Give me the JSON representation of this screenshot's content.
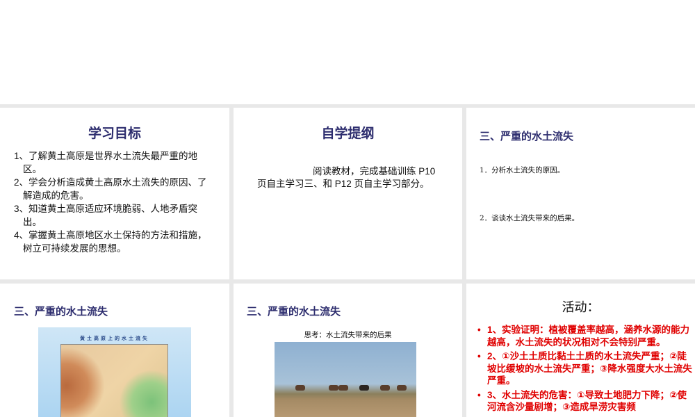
{
  "slide1": {
    "title": "学习目标",
    "items": [
      "1、了解黄土高原是世界水土流失最严重的地区。",
      "2、学会分析造成黄土高原水土流失的原因、了解造成的危害。",
      "3、知道黄土高原适应环境脆弱、人地矛盾突出。",
      "4、掌握黄土高原地区水土保持的方法和措施，树立可持续发展的思想。"
    ]
  },
  "slide2": {
    "title": "自学提纲",
    "line1": "阅读教材，完成基础训练 P10",
    "line2": "页自主学习三、和 P12 页自主学习部分。"
  },
  "slide3": {
    "title": "三、严重的水土流失",
    "q1": "1．分析水土流失的原因。",
    "q2": "2．谈谈水土流失带来的后果。"
  },
  "slide4": {
    "title": "三、严重的水土流失",
    "map_title": "黄土高原上的水土流失"
  },
  "slide5": {
    "title": "三、严重的水土流失",
    "caption": "思考：水土流失带来的后果"
  },
  "slide6": {
    "title": "活动：",
    "items": [
      "1、实验证明：植被覆盖率越高，涵养水源的能力越高，水土流失的状况相对不会特别严重。",
      "2、①沙土土质比黏土土质的水土流失严重；②陡坡比缓坡的水土流失严重；③降水强度大水土流失严重。",
      "3、水土流失的危害：①导致土地肥力下降；②使河流含沙量剧增；③造成旱涝灾害频"
    ]
  }
}
